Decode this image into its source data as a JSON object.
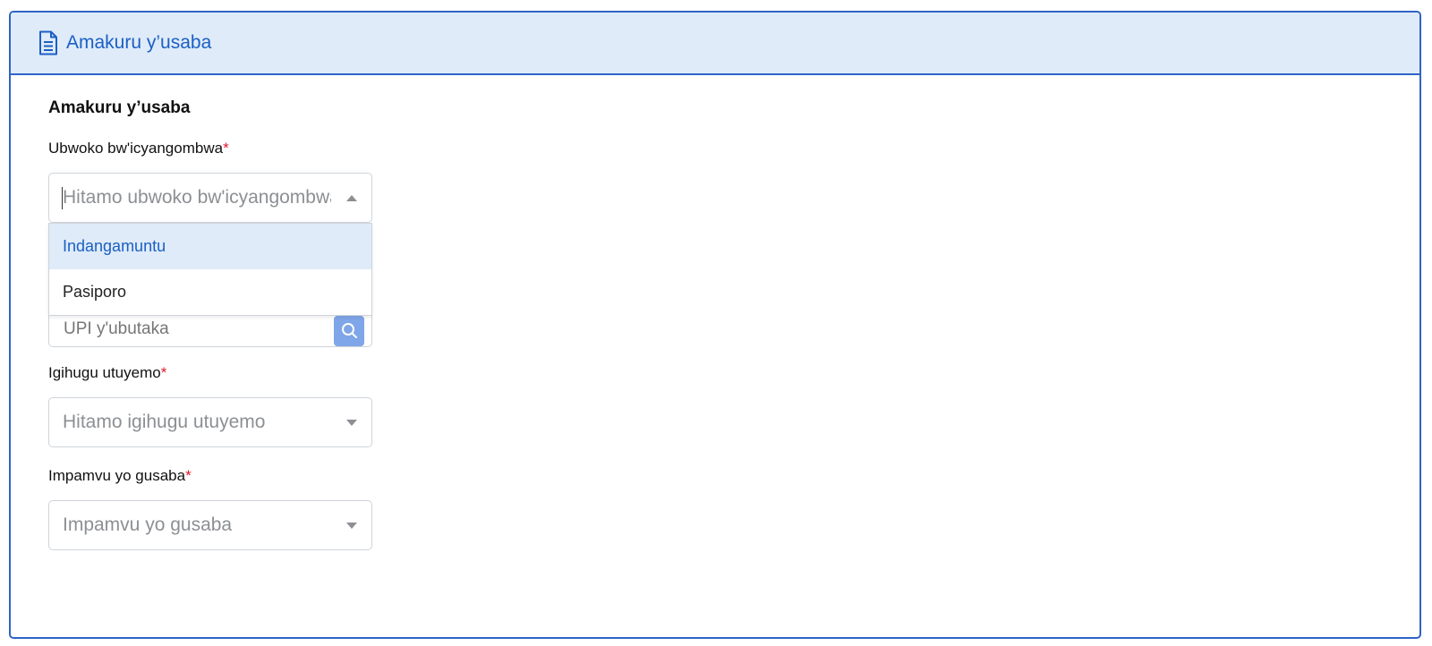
{
  "header": {
    "icon": "document-icon",
    "title": "Amakuru y’usaba"
  },
  "section": {
    "title": "Amakuru y’usaba"
  },
  "colors": {
    "accent": "#1b5fc5",
    "border": "#2f63c9",
    "header_bg": "#dfebf8",
    "required": "#e0182d"
  },
  "fields": {
    "id_type": {
      "label": "Ubwoko bw'icyangombwa",
      "required_mark": "*",
      "placeholder": "Hitamo ubwoko bw'icyangombwa",
      "open": true,
      "options": [
        {
          "label": "Indangamuntu",
          "highlighted": true
        },
        {
          "label": "Pasiporo",
          "highlighted": false
        }
      ]
    },
    "upi": {
      "placeholder": "UPI y'ubutaka",
      "search_icon": "search-icon"
    },
    "country": {
      "label": "Igihugu utuyemo",
      "required_mark": "*",
      "placeholder": "Hitamo igihugu utuyemo"
    },
    "reason": {
      "label": "Impamvu yo gusaba",
      "required_mark": "*",
      "placeholder": "Impamvu yo gusaba"
    }
  }
}
